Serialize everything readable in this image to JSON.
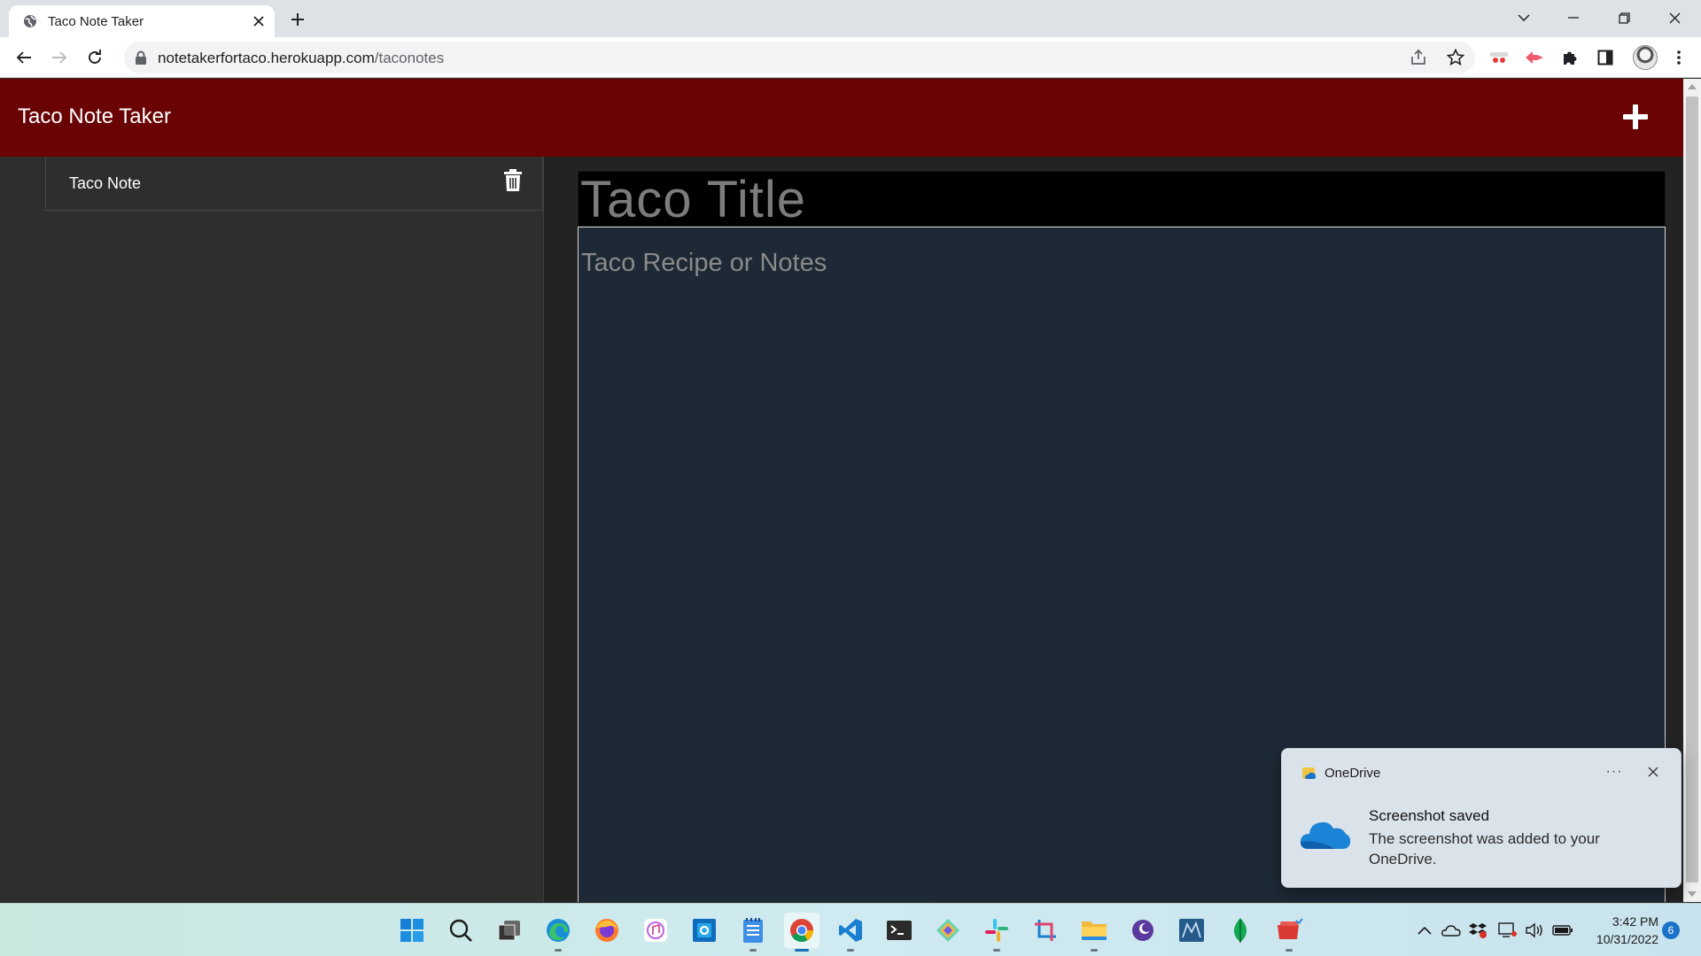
{
  "browser": {
    "tab_title": "Taco Note Taker",
    "url_host": "notetakerfortaco.herokuapp.com",
    "url_path": "/taconotes"
  },
  "app": {
    "brand": "Taco Note Taker",
    "brand_color": "#690304",
    "notes": [
      {
        "title": "Taco Note"
      }
    ],
    "editor": {
      "title_placeholder": "Taco Title",
      "body_placeholder": "Taco Recipe or Notes"
    }
  },
  "toast": {
    "app_name": "OneDrive",
    "more": "···",
    "title": "Screenshot saved",
    "message": "The screenshot was added to your OneDrive."
  },
  "taskbar": {
    "apps": [
      "start",
      "search",
      "task-view",
      "edge",
      "firefox",
      "itunes",
      "outlook",
      "notepad",
      "chrome",
      "vscode",
      "terminal",
      "gitkraken",
      "slack",
      "snipping-tool",
      "file-explorer",
      "tor",
      "mysql-workbench",
      "mongodb-compass",
      "zoom-ext"
    ],
    "time": "3:42 PM",
    "date": "10/31/2022",
    "notification_count": "6"
  }
}
